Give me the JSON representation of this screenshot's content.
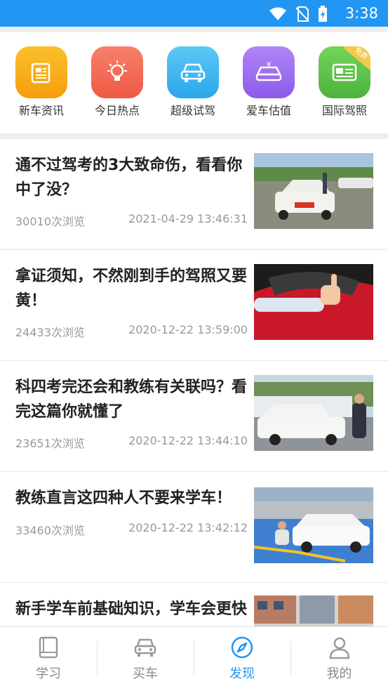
{
  "status_bar": {
    "time": "3:38"
  },
  "quick_actions": [
    {
      "label": "新车资讯",
      "icon": "newspaper-icon",
      "color": "#f7a60e"
    },
    {
      "label": "今日热点",
      "icon": "lightbulb-icon",
      "color": "#f0624d"
    },
    {
      "label": "超级试驾",
      "icon": "car-front-icon",
      "color": "#39b6f0"
    },
    {
      "label": "爱车估值",
      "icon": "car-price-icon",
      "color": "#9b6cf0"
    },
    {
      "label": "国际驾照",
      "icon": "license-card-icon",
      "color": "#55c248",
      "badge": "免费"
    }
  ],
  "articles": [
    {
      "title": "通不过驾考的3大致命伤，看看你中了没？",
      "views": "30010次浏览",
      "date": "2021-04-29 13:46:31"
    },
    {
      "title": "拿证须知，不然刚到手的驾照又要黄！",
      "views": "24433次浏览",
      "date": "2020-12-22 13:59:00"
    },
    {
      "title": "科四考完还会和教练有关联吗？看完这篇你就懂了",
      "views": "23651次浏览",
      "date": "2020-12-22 13:44:10"
    },
    {
      "title": "教练直言这四种人不要来学车！",
      "views": "33460次浏览",
      "date": "2020-12-22 13:42:12"
    },
    {
      "title": "新手学车前基础知识，学车会更快",
      "views": "",
      "date": ""
    }
  ],
  "tabs": [
    {
      "label": "学习",
      "icon": "book-icon",
      "active": false
    },
    {
      "label": "买车",
      "icon": "car-icon",
      "active": false
    },
    {
      "label": "发现",
      "icon": "compass-icon",
      "active": true
    },
    {
      "label": "我的",
      "icon": "user-icon",
      "active": false
    }
  ],
  "colors": {
    "primary": "#2196f3",
    "inactive": "#888888"
  }
}
